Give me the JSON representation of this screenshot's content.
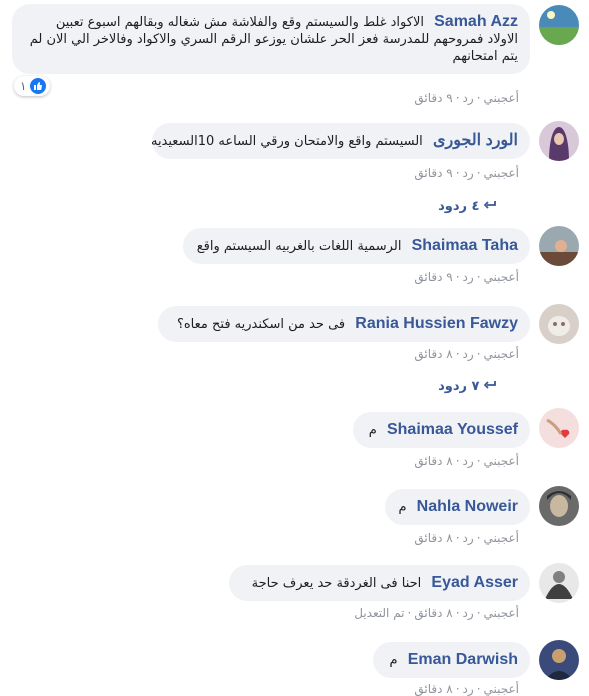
{
  "comments": [
    {
      "author": "Samah Azz",
      "text": "الاكواد غلط والسيستم وقع والفلاشة مش شغاله وبقالهم اسبوع تعبين الاولاد فمروحهم للمدرسة فعز الحر علشان يوزعو الرقم السري والاكواد وفالاخر الي الان لم يتم امتحانهم",
      "like": "أعجبني",
      "reply": "رد",
      "time": "٩ دقائق",
      "reaction_count": "١",
      "avatar_colors": [
        "#4a8ab8",
        "#6aa84f"
      ]
    },
    {
      "author": "الورد الجورى",
      "text": "السيستم واقع والامتحان ورقي الساعه 10السعيديه",
      "like": "أعجبني",
      "reply": "رد",
      "time": "٩ دقائق",
      "avatar_colors": [
        "#c8b8c8",
        "#5a3a6a"
      ]
    },
    {
      "author": "Shaimaa Taha",
      "text": "الرسمية اللغات بالغربيه السيستم واقع",
      "like": "أعجبني",
      "reply": "رد",
      "time": "٩ دقائق",
      "avatar_colors": [
        "#9aa8b0",
        "#6b4a3a"
      ]
    },
    {
      "author": "Rania Hussien Fawzy",
      "text": "فى حد من اسكندريه فتح معاه؟",
      "like": "أعجبني",
      "reply": "رد",
      "time": "٨ دقائق",
      "avatar_colors": [
        "#d8d0c8",
        "#8a7060"
      ]
    },
    {
      "author": "Shaimaa Youssef",
      "text": "م",
      "like": "أعجبني",
      "reply": "رد",
      "time": "٨ دقائق",
      "avatar_colors": [
        "#f4dede",
        "#e23b3b"
      ]
    },
    {
      "author": "Nahla Noweir",
      "text": "م",
      "like": "أعجبني",
      "reply": "رد",
      "time": "٨ دقائق",
      "avatar_colors": [
        "#6a6a6a",
        "#c8b8a0"
      ]
    },
    {
      "author": "Eyad Asser",
      "text": "احنا فى الغردقة حد يعرف حاجة",
      "like": "أعجبني",
      "reply": "رد",
      "time": "٨ دقائق",
      "edited": "تم التعديل",
      "avatar_colors": [
        "#e8e8e8",
        "#404040"
      ]
    },
    {
      "author": "Eman Darwish",
      "text": "م",
      "like": "أعجبني",
      "reply": "رد",
      "time": "٨ دقائق",
      "avatar_colors": [
        "#3a4a7a",
        "#c8a070"
      ]
    }
  ],
  "reply_links": [
    {
      "label": "٤ ردود"
    },
    {
      "label": "٧ ردود"
    }
  ],
  "colors": {
    "bubble": "#f0f2f5",
    "author": "#385898",
    "meta": "#90949c",
    "like_blue": "#1877f2"
  }
}
